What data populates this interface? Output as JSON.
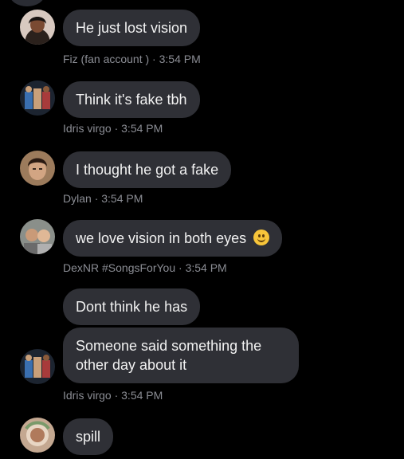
{
  "messages": [
    {
      "text": "He just lost vision",
      "author": "Fiz (fan account )",
      "time": "3:54 PM",
      "avatar": "fiz-avatar"
    },
    {
      "text": "Think it's fake tbh",
      "author": "Idris virgo",
      "time": "3:54 PM",
      "avatar": "idris-avatar"
    },
    {
      "text": "I thought he got a fake",
      "author": "Dylan",
      "time": "3:54 PM",
      "avatar": "dylan-avatar"
    },
    {
      "text": "we love vision in both eyes",
      "emoji": "slightly-smiling-face",
      "author": "DexNR #SongsForYou",
      "time": "3:54 PM",
      "avatar": "dex-avatar"
    },
    {
      "text": "Dont think he has"
    },
    {
      "text": "Someone said something the other day about it",
      "author": "Idris virgo",
      "time": "3:54 PM",
      "avatar": "idris-avatar"
    },
    {
      "text": "spill",
      "avatar": "spill-avatar"
    }
  ],
  "meta_separator": "·",
  "colors": {
    "background": "#000000",
    "bubble": "#2f3036",
    "bubble_text": "#f2f2f2",
    "meta_text": "#8b8d94"
  }
}
